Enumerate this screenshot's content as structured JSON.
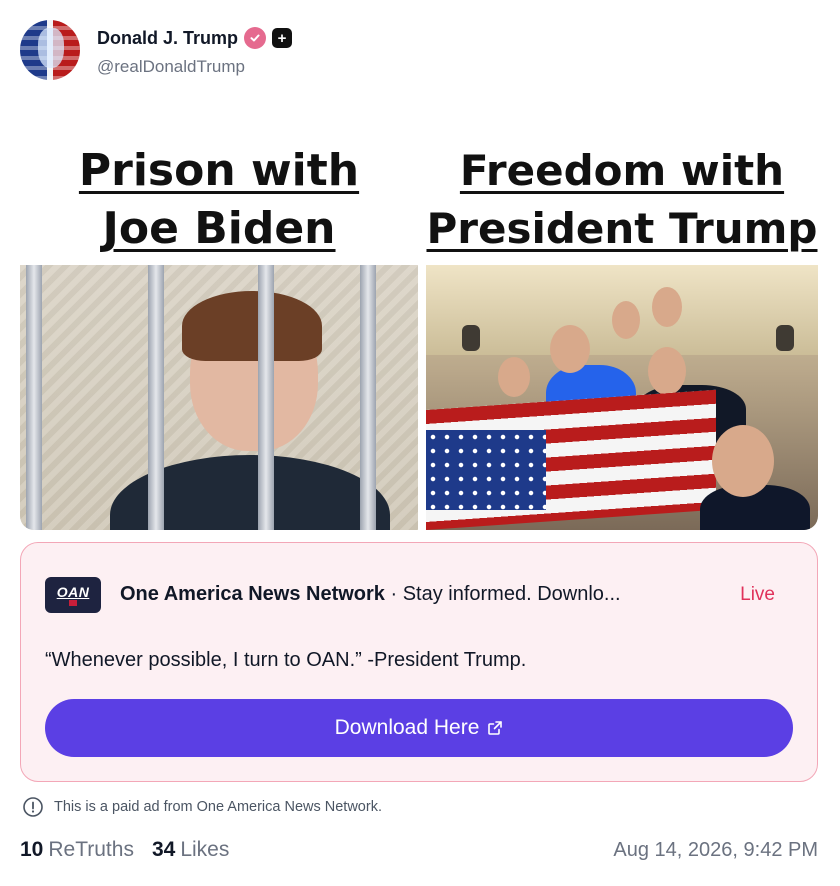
{
  "post": {
    "author": {
      "display_name": "Donald J. Trump",
      "handle": "@realDonaldTrump"
    },
    "media": {
      "left_headline_line1": "Prison with",
      "left_headline_line2": "Joe Biden",
      "right_headline_line1": "Freedom with",
      "right_headline_line2": "President Trump"
    },
    "ad": {
      "logo_text": "OAN",
      "advertiser": "One America News Network",
      "separator": " · ",
      "tagline": "Stay informed. Downlo...",
      "live_label": "Live",
      "quote": "“Whenever possible, I turn to OAN.” -President Trump.",
      "button_label": "Download Here"
    },
    "disclaimer": "This is a paid ad from One America News Network.",
    "stats": {
      "retruths_count": "10",
      "retruths_label": "ReTruths",
      "likes_count": "34",
      "likes_label": "Likes"
    },
    "timestamp": "Aug 14, 2026, 9:42 PM"
  },
  "colors": {
    "verified_badge": "#e56a8f",
    "ad_border": "#f3a7b7",
    "ad_background": "#fdf0f3",
    "live_text": "#e0315a",
    "button": "#5b3fe4"
  },
  "icons": [
    "verified-icon",
    "plus-icon",
    "external-link-icon",
    "info-icon"
  ]
}
